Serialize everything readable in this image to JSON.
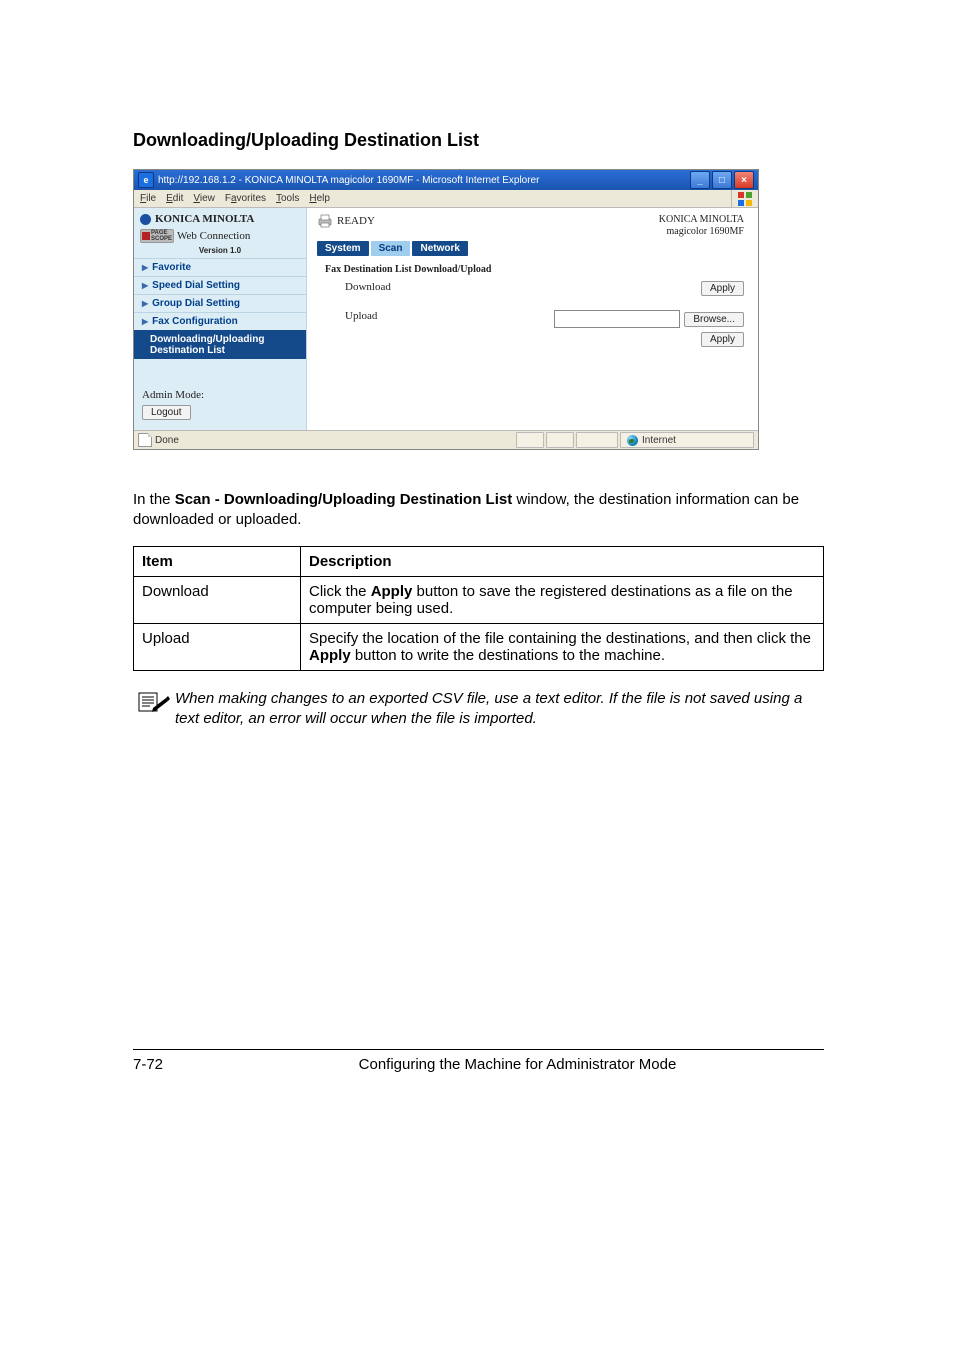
{
  "heading": "Downloading/Uploading Destination List",
  "browser": {
    "title": "http://192.168.1.2 - KONICA MINOLTA magicolor 1690MF - Microsoft Internet Explorer",
    "menus": {
      "file": "File",
      "edit": "Edit",
      "view": "View",
      "favorites": "Favorites",
      "tools": "Tools",
      "help": "Help"
    },
    "status_done": "Done",
    "status_internet": "Internet"
  },
  "sidebar": {
    "brand": "KONICA MINOLTA",
    "pagescope": {
      "page": "PAGE",
      "scope": "SCOPE"
    },
    "web_connection": "Web Connection",
    "version": "Version 1.0",
    "items": {
      "favorite": "Favorite",
      "speed_dial": "Speed Dial Setting",
      "group_dial": "Group Dial Setting",
      "fax_config": "Fax Configuration",
      "down_up": "Downloading/Uploading Destination List"
    },
    "admin_mode": "Admin Mode:",
    "logout": "Logout"
  },
  "main": {
    "ready": "READY",
    "corp1": "KONICA MINOLTA",
    "corp2": "magicolor 1690MF",
    "tabs": {
      "system": "System",
      "scan": "Scan",
      "network": "Network"
    },
    "section_title": "Fax Destination List Download/Upload",
    "download_label": "Download",
    "upload_label": "Upload",
    "apply": "Apply",
    "browse": "Browse..."
  },
  "para": {
    "before": "In the ",
    "bold": "Scan - Downloading/Uploading Destination List",
    "after": " window, the destination information can be downloaded or uploaded."
  },
  "table": {
    "h1": "Item",
    "h2": "Description",
    "r1c1": "Download",
    "r1c2_before": "Click the ",
    "r1c2_bold": "Apply",
    "r1c2_after": " button to save the registered destinations as a file on the computer being used.",
    "r2c1": "Upload",
    "r2c2_before": "Specify the location of the file containing the destinations, and then click the ",
    "r2c2_bold": "Apply",
    "r2c2_after": " button to write the destinations to the machine."
  },
  "note": "When making changes to an exported CSV file, use a text editor. If the file is not saved using a text editor, an error will occur when the file is imported.",
  "footer": {
    "page": "7-72",
    "text": "Configuring the Machine for Administrator Mode"
  }
}
